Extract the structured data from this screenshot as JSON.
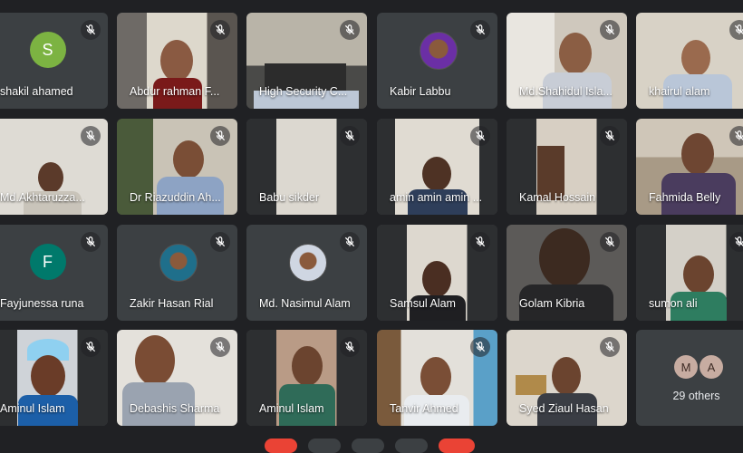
{
  "participants": [
    {
      "name": "shakil ahamed",
      "avatar_letter": "S",
      "avatar_color": "#7cb342"
    },
    {
      "name": "Abdur rahman F..."
    },
    {
      "name": "High Security C..."
    },
    {
      "name": "Kabir Labbu"
    },
    {
      "name": "Md.Shahidul Isla..."
    },
    {
      "name": "khairul alam"
    },
    {
      "name": "Md.Akhtaruzza..."
    },
    {
      "name": "Dr Riazuddin Ah..."
    },
    {
      "name": "Babu sikder"
    },
    {
      "name": "amin amin amin ..."
    },
    {
      "name": "Kamal Hossain"
    },
    {
      "name": "Fahmida Belly"
    },
    {
      "name": "Fayjunessa runa",
      "avatar_letter": "F",
      "avatar_color": "#00796b"
    },
    {
      "name": "Zakir Hasan Rial"
    },
    {
      "name": "Md. Nasimul Alam"
    },
    {
      "name": "Samsul Alam"
    },
    {
      "name": "Golam Kibria"
    },
    {
      "name": "sumon ali"
    },
    {
      "name": "Aminul Islam"
    },
    {
      "name": "Debashis Sharma"
    },
    {
      "name": "Aminul Islam"
    },
    {
      "name": "Tanvir Ahmed"
    },
    {
      "name": "Syed Ziaul Hasan"
    }
  ],
  "others": {
    "initials": [
      "M",
      "A"
    ],
    "count_label": "29 others"
  },
  "icons": {
    "mic": "mic-off-icon"
  }
}
